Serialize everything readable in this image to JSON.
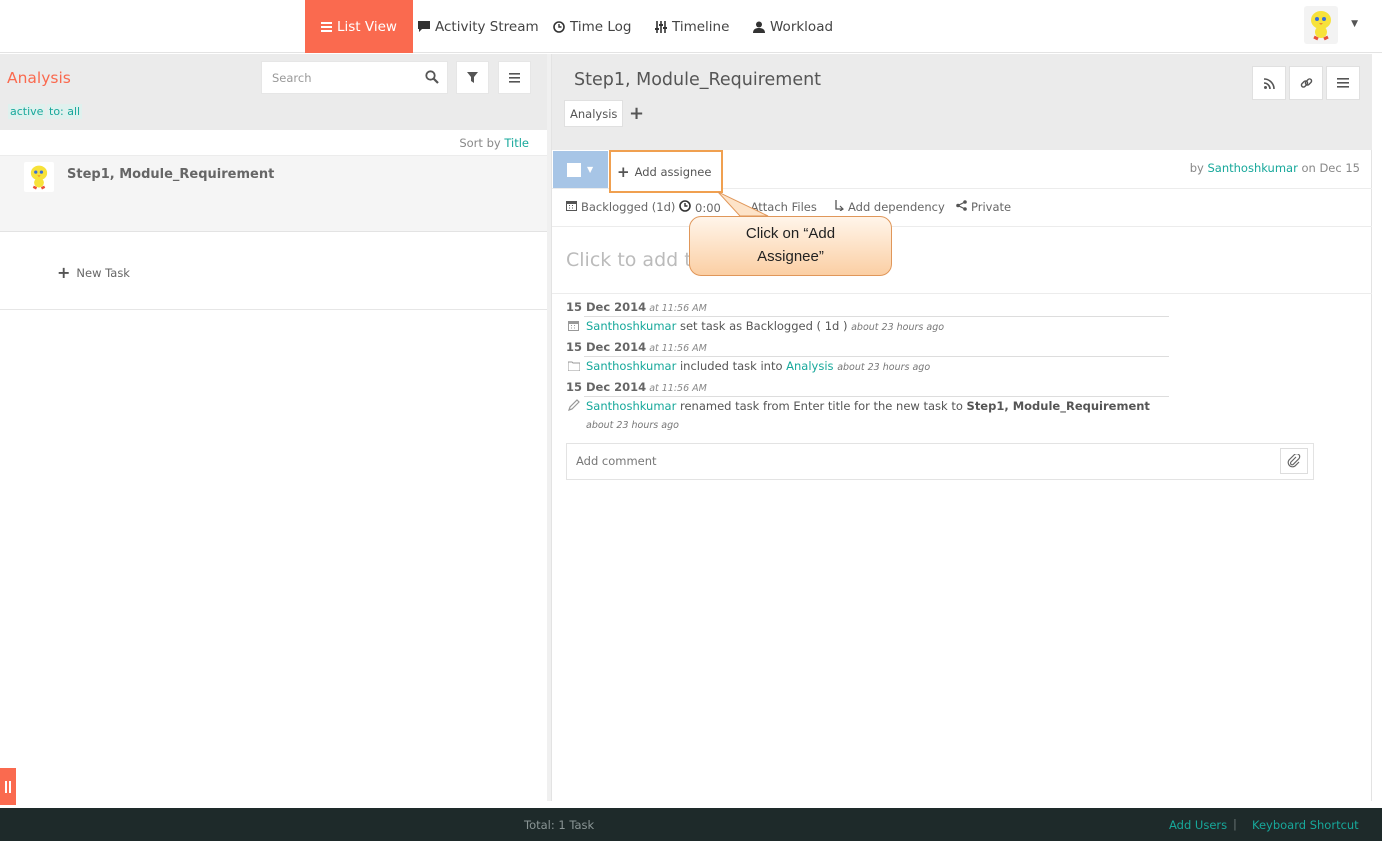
{
  "nav": {
    "items": [
      {
        "label": "List View",
        "icon": "list-icon",
        "active": true
      },
      {
        "label": "Activity Stream",
        "icon": "comment-icon",
        "active": false
      },
      {
        "label": "Time Log",
        "icon": "clock-icon",
        "active": false
      },
      {
        "label": "Timeline",
        "icon": "sliders-icon",
        "active": false
      },
      {
        "label": "Workload",
        "icon": "user-icon",
        "active": false
      }
    ],
    "accent": "#fa6a4f"
  },
  "left": {
    "project_title": "Analysis",
    "filters": [
      "active",
      "to: all"
    ],
    "search_placeholder": "Search",
    "sort_prefix": "Sort by",
    "sort_field": "Title",
    "task_title": "Step1, Module_Requirement",
    "new_task_label": "New Task"
  },
  "detail": {
    "title": "Step1, Module_Requirement",
    "project_tag": "Analysis",
    "add_assignee": "Add assignee",
    "created_prefix": "by",
    "created_by": "Santhoshkumar",
    "created_suffix": "on Dec 15",
    "meta": {
      "status": "Backlogged (1d)",
      "time": "0:00",
      "attach": "Attach Files",
      "dependency": "Add dependency",
      "privacy": "Private"
    },
    "description_placeholder": "Click to add th",
    "activity": [
      {
        "date": "15 Dec 2014",
        "time": "at 11:56 AM",
        "user": "Santhoshkumar",
        "text": "set task as Backlogged ( 1d )",
        "ago": "about 23 hours ago"
      },
      {
        "date": "15 Dec 2014",
        "time": "at 11:56 AM",
        "user": "Santhoshkumar",
        "text": "included task into",
        "link": "Analysis",
        "ago": "about 23 hours ago"
      },
      {
        "date": "15 Dec 2014",
        "time": "at 11:56 AM",
        "user": "Santhoshkumar",
        "text": "renamed task from Enter title for the new task to",
        "bold": "Step1, Module_Requirement",
        "ago": "about 23 hours ago"
      }
    ],
    "comment_placeholder": "Add comment"
  },
  "callout": {
    "line1": "Click on “Add",
    "line2": "Assignee”"
  },
  "footer": {
    "total": "Total: 1 Task",
    "add_users": "Add Users",
    "separator": "|",
    "keyboard_shortcut": "Keyboard Shortcut"
  },
  "colors": {
    "link": "#17a89b",
    "footer_bg": "#1e2a2a"
  }
}
